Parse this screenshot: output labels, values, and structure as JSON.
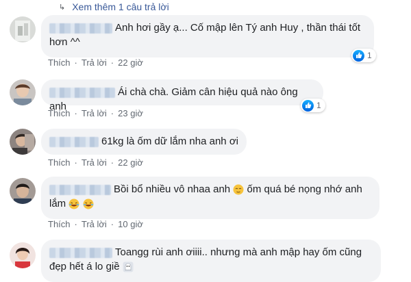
{
  "more_replies": {
    "arrow": "↳",
    "label": "Xem thêm 1 câu trả lời"
  },
  "colors": {
    "bubble": "#f2f3f5",
    "link": "#385898",
    "meta": "#606770",
    "like": "#1877f2"
  },
  "comments": [
    {
      "text_line1": "Anh hơi gầy ạ... Cố mập lên Tý anh Huy , thần thái tốt",
      "text_line2": "hơn ^^",
      "like": "Thích",
      "reply": "Trả lời",
      "time": "22 giờ",
      "reaction_count": "1"
    },
    {
      "text_line1": "Ái chà chà. Giảm cân hiệu quả nào ông anh",
      "like": "Thích",
      "reply": "Trả lời",
      "time": "23 giờ",
      "reaction_count": "1"
    },
    {
      "text_line1": "61kg là ốm dữ lắm nha anh ơi",
      "like": "Thích",
      "reply": "Trả lời",
      "time": "22 giờ"
    },
    {
      "text_line1": "Bồi bổ nhiều vô nhaa anh",
      "text_line1b": "ốm quá bé nọng nhớ anh",
      "text_line2": "lắm",
      "like": "Thích",
      "reply": "Trả lời",
      "time": "10 giờ"
    },
    {
      "text_line1": "Toangg rùi anh ơiiii.. nhưng mà anh mập hay ốm cũng",
      "text_line2": "đẹp hết á lo giề"
    }
  ]
}
